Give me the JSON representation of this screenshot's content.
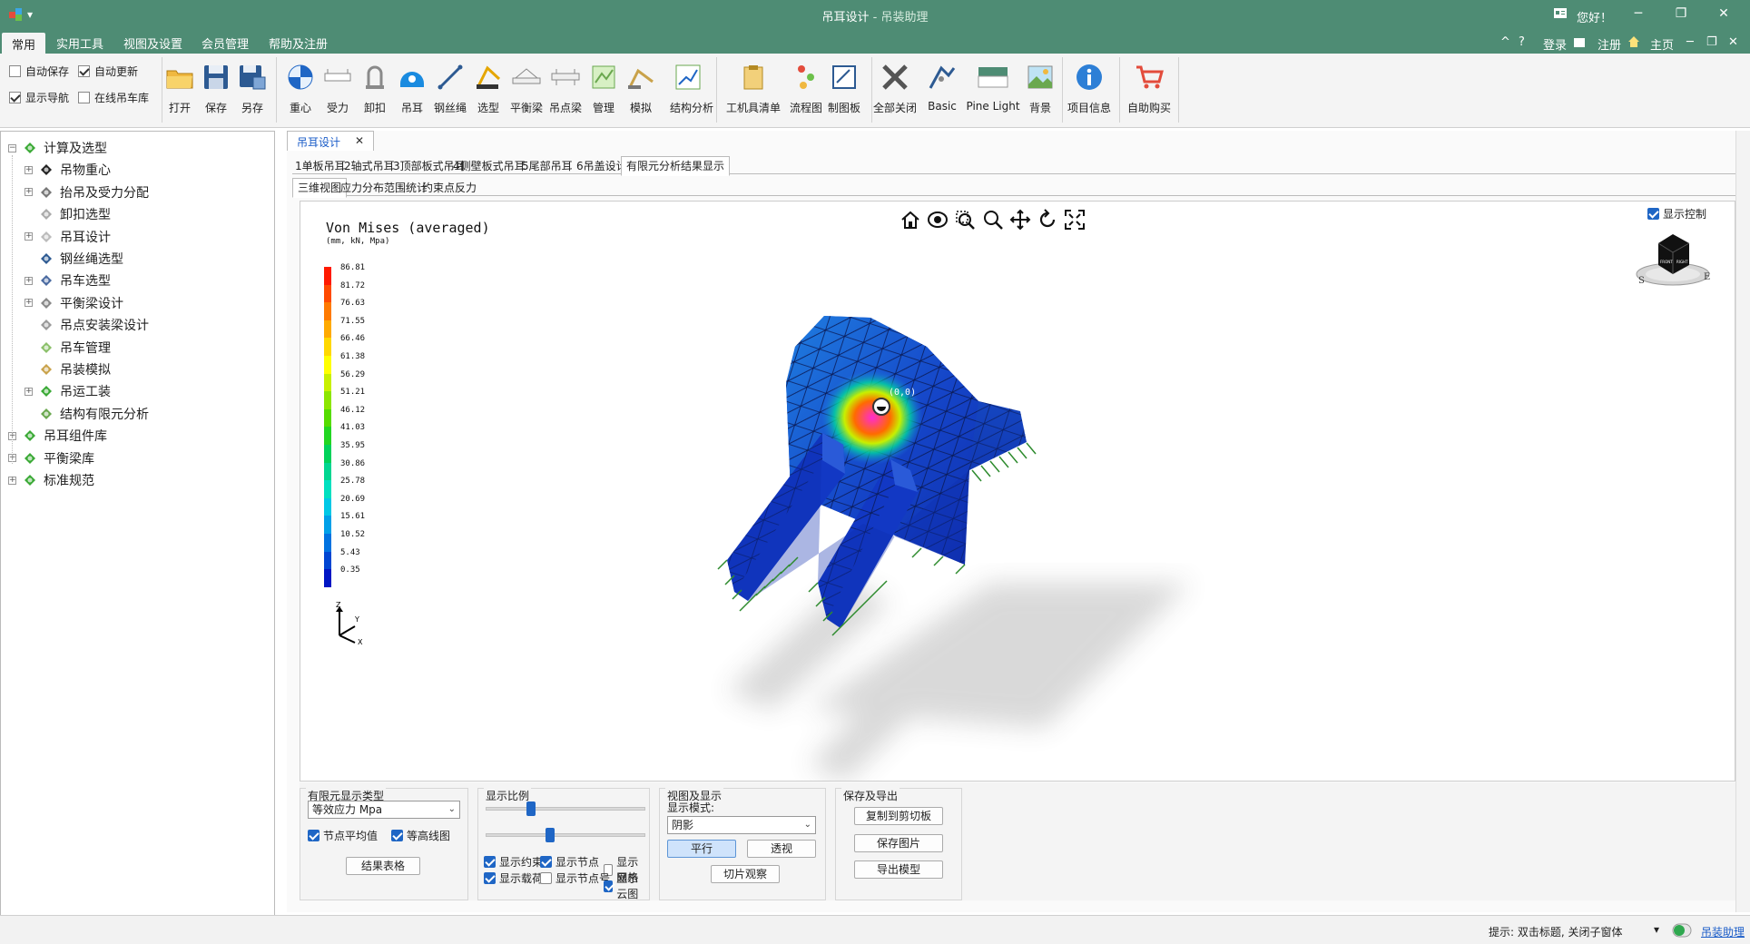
{
  "titlebar": {
    "app_title": "吊耳设计",
    "separator": " - ",
    "app_sub": "吊装助理",
    "greeting": "您好！",
    "min": "─",
    "max": "❐",
    "close": "✕",
    "app_icon": "app-logo-icon",
    "qa_arrow": "▾"
  },
  "menu": {
    "items": [
      "常用",
      "实用工具",
      "视图及设置",
      "会员管理",
      "帮助及注册"
    ],
    "active": 0,
    "right": {
      "collapse": "^",
      "help": "?",
      "login": "登录",
      "register": "注册",
      "home": "主页",
      "min": "─",
      "restore": "❐",
      "close": "✕"
    }
  },
  "ribbon": {
    "checks": [
      {
        "label": "自动保存",
        "checked": false
      },
      {
        "label": "自动更新",
        "checked": true
      },
      {
        "label": "显示导航",
        "checked": true
      },
      {
        "label": "在线吊车库",
        "checked": false
      }
    ],
    "file": [
      "打开",
      "保存",
      "另存"
    ],
    "tools": [
      "重心",
      "受力",
      "卸扣",
      "吊耳",
      "钢丝绳",
      "选型",
      "平衡梁",
      "吊点梁",
      "管理",
      "模拟",
      "结构分析"
    ],
    "docs": [
      "工机具清单",
      "流程图",
      "制图板"
    ],
    "view": [
      "全部关闭",
      "Basic",
      "Pine Light",
      "背景"
    ],
    "info": [
      "项目信息"
    ],
    "shop": [
      "自助购买"
    ]
  },
  "nav": {
    "items": [
      {
        "label": "计算及选型",
        "level": 0,
        "expanded": true,
        "icon": "puzzle-icon"
      },
      {
        "label": "吊物重心",
        "level": 1,
        "expandable": true,
        "icon": "center-icon"
      },
      {
        "label": "抬吊及受力分配",
        "level": 1,
        "expandable": true,
        "icon": "force-icon"
      },
      {
        "label": "卸扣选型",
        "level": 1,
        "expandable": false,
        "icon": "shackle-icon"
      },
      {
        "label": "吊耳设计",
        "level": 1,
        "expandable": true,
        "icon": "lug-icon"
      },
      {
        "label": "钢丝绳选型",
        "level": 1,
        "expandable": false,
        "icon": "rope-icon"
      },
      {
        "label": "吊车选型",
        "level": 1,
        "expandable": true,
        "icon": "crane-icon"
      },
      {
        "label": "平衡梁设计",
        "level": 1,
        "expandable": true,
        "icon": "beam-icon"
      },
      {
        "label": "吊点安装梁设计",
        "level": 1,
        "expandable": false,
        "icon": "beam2-icon"
      },
      {
        "label": "吊车管理",
        "level": 1,
        "expandable": false,
        "icon": "map-icon"
      },
      {
        "label": "吊装模拟",
        "level": 1,
        "expandable": false,
        "icon": "sim-icon"
      },
      {
        "label": "吊运工装",
        "level": 1,
        "expandable": true,
        "icon": "puzzle-icon"
      },
      {
        "label": "结构有限元分析",
        "level": 1,
        "expandable": false,
        "icon": "chart-icon"
      },
      {
        "label": "吊耳组件库",
        "level": 0,
        "expanded": false,
        "icon": "puzzle-icon"
      },
      {
        "label": "平衡梁库",
        "level": 0,
        "expanded": false,
        "icon": "puzzle-icon"
      },
      {
        "label": "标准规范",
        "level": 0,
        "expanded": false,
        "icon": "puzzle-icon"
      }
    ]
  },
  "doc": {
    "tab": "吊耳设计",
    "tab_close": "✕",
    "subtabs": [
      "1单板吊耳",
      "2轴式吊耳",
      "3顶部板式吊耳",
      "4侧壁板式吊耳",
      "5尾部吊耳",
      "6吊盖设计",
      "有限元分析结果显示"
    ],
    "subtab_active": 6,
    "viewtabs": [
      "三维视图",
      "应力分布范围统计",
      "约束点反力"
    ],
    "viewtab_active": 0
  },
  "viewport": {
    "title": "Von Mises (averaged)",
    "units": "(mm, kN, Mpa)",
    "show_control": "显示控制",
    "show_control_checked": true,
    "legend": [
      "86.81",
      "81.72",
      "76.63",
      "71.55",
      "66.46",
      "61.38",
      "56.29",
      "51.21",
      "46.12",
      "41.03",
      "35.95",
      "30.86",
      "25.78",
      "20.69",
      "15.61",
      "10.52",
      "5.43",
      "0.35"
    ],
    "legend_colors": [
      "#ff1a00",
      "#ff4a00",
      "#ff7a00",
      "#ffaa00",
      "#ffd800",
      "#ffff00",
      "#c8f000",
      "#8ce600",
      "#55dc00",
      "#22d622",
      "#00d25a",
      "#00d690",
      "#00e0c0",
      "#00c8e6",
      "#00a0e8",
      "#0072e0",
      "#0046d2",
      "#0016c4"
    ],
    "pick_label": "(0,0)",
    "cube_front": "FRONT",
    "cube_right": "RIGHT",
    "cube_s": "S",
    "cube_e": "E",
    "axes": {
      "z": "Z",
      "y": "Y",
      "x": "X"
    },
    "toolbar": [
      "home-icon",
      "orbit-icon",
      "zoom-window-icon",
      "zoom-icon",
      "pan-icon",
      "rotate-icon",
      "fit-icon"
    ]
  },
  "controls": {
    "fe_type": {
      "title": "有限元显示类型",
      "select": "等效应力 Mpa",
      "node_avg": "节点平均值",
      "node_avg_checked": true,
      "contour": "等高线图",
      "contour_checked": true,
      "table_btn": "结果表格"
    },
    "scale": {
      "title": "显示比例",
      "slider1": 0.28,
      "slider2": 0.4,
      "checks": [
        {
          "label": "显示约束",
          "checked": true
        },
        {
          "label": "显示节点",
          "checked": true
        },
        {
          "label": "显示网格",
          "checked": false
        },
        {
          "label": "显示载荷",
          "checked": true
        },
        {
          "label": "显示节点号",
          "checked": false
        },
        {
          "label": "显示云图",
          "checked": true
        }
      ]
    },
    "view": {
      "title": "视图及显示",
      "mode_label": "显示模式:",
      "mode": "阴影",
      "parallel": "平行",
      "perspective": "透视",
      "slice": "切片观察"
    },
    "export": {
      "title": "保存及导出",
      "copy": "复制到剪切板",
      "save_img": "保存图片",
      "export_model": "导出模型"
    }
  },
  "status": {
    "tip": "提示: 双击标题, 关闭子窗体",
    "link": "吊装助理",
    "arrow": "▾"
  }
}
